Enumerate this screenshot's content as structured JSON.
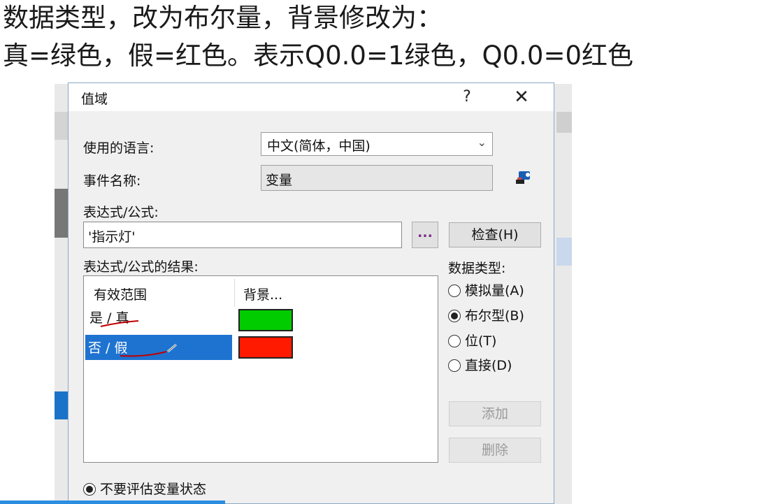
{
  "caption": {
    "line1": "数据类型，改为布尔量，背景修改为：",
    "line2": "真=绿色，假=红色。表示Q0.0=1绿色，Q0.0=0红色"
  },
  "dialog": {
    "title": "值域",
    "help_glyph": "?",
    "close_glyph": "✕",
    "language_label": "使用的语言:",
    "language_value": "中文(简体，中国)",
    "event_label": "事件名称:",
    "event_value": "变量",
    "expression_label": "表达式/公式:",
    "expression_value": "'指示灯'",
    "browse_label": "...",
    "check_label": "检查(H)",
    "results_label": "表达式/公式的结果:",
    "results": {
      "columns": [
        "有效范围",
        "背景..."
      ],
      "rows": [
        {
          "range": "是 / 真",
          "color": "#00cc00"
        },
        {
          "range": "否 / 假",
          "color": "#ff1a00"
        }
      ]
    },
    "datatype_label": "数据类型:",
    "datatype_options": [
      "模拟量(A)",
      "布尔型(B)",
      "位(T)",
      "直接(D)"
    ],
    "datatype_selected": "布尔型(B)",
    "add_label": "添加",
    "delete_label": "删除",
    "bottom_option": "不要评估变量状态"
  },
  "colors": {
    "selection": "#1e73d0",
    "annotation_ink": "#c00000"
  }
}
